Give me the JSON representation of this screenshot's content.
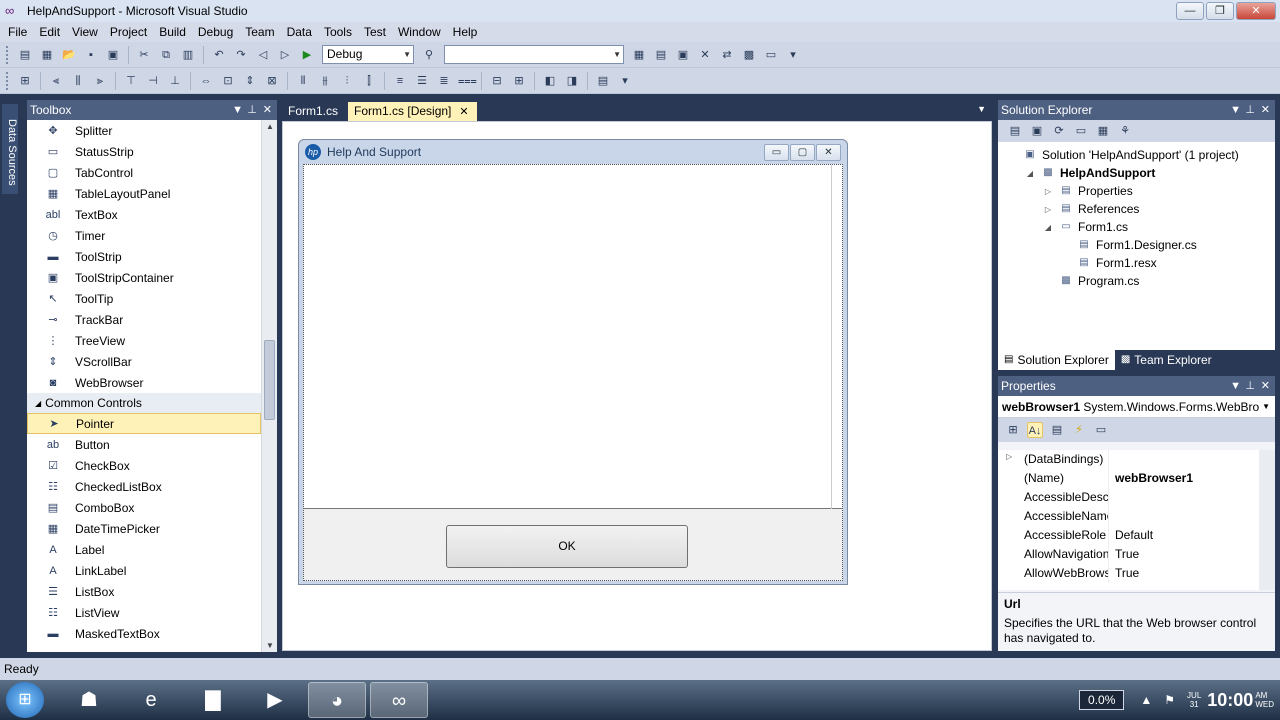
{
  "window": {
    "title": "HelpAndSupport - Microsoft Visual Studio",
    "minimize": "—",
    "maximize": "❐",
    "close": "✕"
  },
  "menu": [
    "File",
    "Edit",
    "View",
    "Project",
    "Build",
    "Debug",
    "Team",
    "Data",
    "Tools",
    "Test",
    "Window",
    "Help"
  ],
  "toolbar": {
    "config": "Debug",
    "platform": ""
  },
  "left_strip": {
    "label": "Data Sources"
  },
  "toolbox": {
    "title": "Toolbox",
    "items_top": [
      {
        "icon": "✥",
        "label": "Splitter"
      },
      {
        "icon": "▭",
        "label": "StatusStrip"
      },
      {
        "icon": "▢",
        "label": "TabControl"
      },
      {
        "icon": "▦",
        "label": "TableLayoutPanel"
      },
      {
        "icon": "abl",
        "label": "TextBox"
      },
      {
        "icon": "◷",
        "label": "Timer"
      },
      {
        "icon": "▬",
        "label": "ToolStrip"
      },
      {
        "icon": "▣",
        "label": "ToolStripContainer"
      },
      {
        "icon": "↖",
        "label": "ToolTip"
      },
      {
        "icon": "⊸",
        "label": "TrackBar"
      },
      {
        "icon": "⋮",
        "label": "TreeView"
      },
      {
        "icon": "⇕",
        "label": "VScrollBar"
      },
      {
        "icon": "◙",
        "label": "WebBrowser"
      }
    ],
    "category": "Common Controls",
    "items_common": [
      {
        "icon": "➤",
        "label": "Pointer"
      },
      {
        "icon": "ab",
        "label": "Button"
      },
      {
        "icon": "☑",
        "label": "CheckBox"
      },
      {
        "icon": "☷",
        "label": "CheckedListBox"
      },
      {
        "icon": "▤",
        "label": "ComboBox"
      },
      {
        "icon": "▦",
        "label": "DateTimePicker"
      },
      {
        "icon": "A",
        "label": "Label"
      },
      {
        "icon": "A",
        "label": "LinkLabel"
      },
      {
        "icon": "☰",
        "label": "ListBox"
      },
      {
        "icon": "☷",
        "label": "ListView"
      },
      {
        "icon": "▬",
        "label": "MaskedTextBox"
      }
    ]
  },
  "editor": {
    "tabs": [
      {
        "label": "Form1.cs",
        "active": false
      },
      {
        "label": "Form1.cs [Design]",
        "active": true
      }
    ]
  },
  "form": {
    "title": "Help And Support",
    "ok_label": "OK"
  },
  "solution_explorer": {
    "title": "Solution Explorer",
    "tree": [
      {
        "label": "Solution 'HelpAndSupport' (1 project)",
        "level": 0,
        "exp": "",
        "icon": "▣",
        "bold": false
      },
      {
        "label": "HelpAndSupport",
        "level": 1,
        "exp": "◢",
        "icon": "▩",
        "bold": true
      },
      {
        "label": "Properties",
        "level": 2,
        "exp": "▷",
        "icon": "▤",
        "bold": false
      },
      {
        "label": "References",
        "level": 2,
        "exp": "▷",
        "icon": "▤",
        "bold": false
      },
      {
        "label": "Form1.cs",
        "level": 2,
        "exp": "◢",
        "icon": "▭",
        "bold": false
      },
      {
        "label": "Form1.Designer.cs",
        "level": 3,
        "exp": "",
        "icon": "▤",
        "bold": false
      },
      {
        "label": "Form1.resx",
        "level": 3,
        "exp": "",
        "icon": "▤",
        "bold": false
      },
      {
        "label": "Program.cs",
        "level": 2,
        "exp": "",
        "icon": "▩",
        "bold": false
      }
    ],
    "tabs": [
      "Solution Explorer",
      "Team Explorer"
    ]
  },
  "properties": {
    "title": "Properties",
    "object_name": "webBrowser1",
    "object_type": "System.Windows.Forms.WebBro",
    "rows": [
      {
        "name": "(DataBindings)",
        "value": "",
        "expandable": true
      },
      {
        "name": "(Name)",
        "value": "webBrowser1",
        "expandable": false
      },
      {
        "name": "AccessibleDescriptic",
        "value": "",
        "expandable": false
      },
      {
        "name": "AccessibleName",
        "value": "",
        "expandable": false
      },
      {
        "name": "AccessibleRole",
        "value": "Default",
        "expandable": false
      },
      {
        "name": "AllowNavigation",
        "value": "True",
        "expandable": false
      },
      {
        "name": "AllowWebBrowserDr",
        "value": "True",
        "expandable": false
      }
    ],
    "desc_title": "Url",
    "desc_text": "Specifies the URL that the Web browser control has navigated to."
  },
  "status": {
    "text": "Ready"
  },
  "taskbar": {
    "percent": "0.0%",
    "date_top": "JUL",
    "date_bottom": "31",
    "time": "10:00",
    "ampm_top": "AM",
    "ampm_bottom": "WED"
  }
}
